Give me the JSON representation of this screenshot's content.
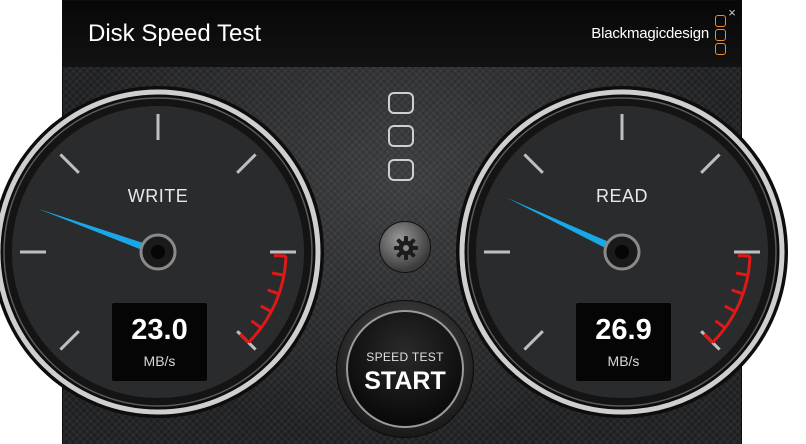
{
  "window": {
    "title": "Disk Speed Test",
    "close_glyph": "×"
  },
  "brand": {
    "name": "Blackmagicdesign",
    "logo_color": "#f28c2a",
    "logo_icon": "blackmagic-logo-icon"
  },
  "gauges": {
    "write": {
      "label": "WRITE",
      "value": "23.0",
      "unit": "MB/s",
      "needle_fraction": 0.24
    },
    "read": {
      "label": "READ",
      "value": "26.9",
      "unit": "MB/s",
      "needle_fraction": 0.26
    }
  },
  "indicators": {
    "count": 3,
    "icon": "stack-indicator-icon"
  },
  "settings": {
    "icon": "gear-icon"
  },
  "start_button": {
    "subtitle": "SPEED TEST",
    "label": "START"
  },
  "colors": {
    "needle": "#1aa7e6",
    "danger_zone": "#e01818",
    "tick": "#bfbfbf"
  }
}
